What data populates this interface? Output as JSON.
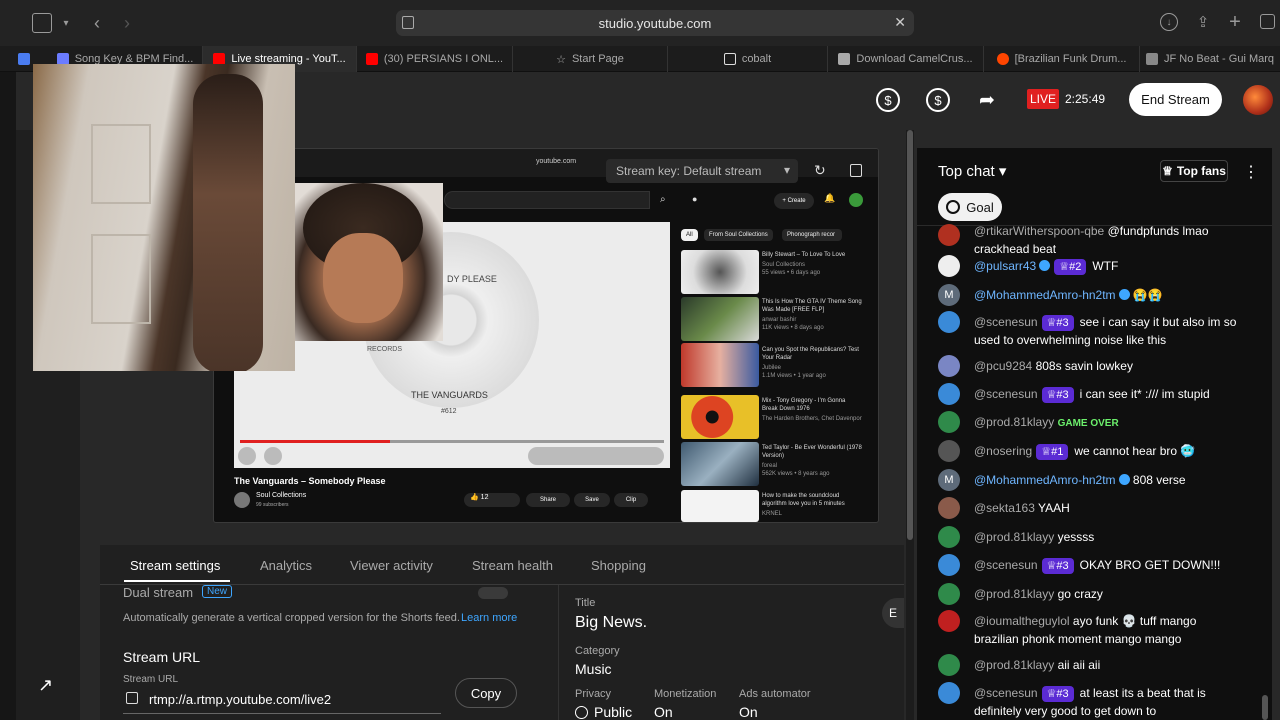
{
  "browser": {
    "url": "studio.youtube.com",
    "tabs": [
      {
        "label": "Song Key & BPM Find...",
        "color": "#6b7cff"
      },
      {
        "label": "Live streaming - YouT...",
        "color": "#ff0000",
        "active": true
      },
      {
        "label": "(30) PERSIANS I ONL...",
        "color": "#ff0000"
      },
      {
        "label": "Start Page",
        "color": "#999999"
      },
      {
        "label": "cobalt",
        "color": "#dddddd"
      },
      {
        "label": "Download CamelCrus...",
        "color": "#aaaaaa"
      },
      {
        "label": "[Brazilian Funk Drum...",
        "color": "#ff4500"
      },
      {
        "label": "JF No Beat - Gui Marq",
        "color": "#888888"
      }
    ]
  },
  "header": {
    "live_label": "LIVE",
    "timer": "2:25:49",
    "end_stream": "End Stream"
  },
  "preview": {
    "stream_key": "Stream key: Default stream",
    "inner_url": "youtube.com",
    "create": "Create",
    "chips": [
      "All",
      "From Soul Collections",
      "Phonograph recor"
    ],
    "video_title": "The Vanguards – Somebody Please",
    "channel": "Soul Collections",
    "subscribers": "99 subscribers",
    "likes": "12",
    "actions": [
      "Share",
      "Save",
      "Clip"
    ],
    "record_title": "THE VANGUARDS",
    "record_label": "RECORDS",
    "record_song": "DY PLEASE",
    "record_number": "#612",
    "suggestions": [
      {
        "title": "Billy Stewart – To Love To Love",
        "meta": "Soul Collections",
        "stats": "55 views • 6 days ago",
        "duration": "2:46"
      },
      {
        "title": "This Is How The GTA IV Theme Song Was Made [FREE FLP]",
        "meta": "anwar bashir",
        "stats": "11K views • 8 days ago",
        "duration": "4:20"
      },
      {
        "title": "Can you Spot the Republicans? Test Your Radar",
        "meta": "Jubilee",
        "stats": "1.1M views • 1 year ago",
        "duration": "16:31"
      },
      {
        "title": "Mix - Tony Gregory - I'm Gonna Break Down 1976",
        "meta": "The Harden Brothers, Chet Davenport, Th...",
        "stats": "",
        "duration": "Mix"
      },
      {
        "title": "Ted Taylor - Be Ever Wonderful (1978 Version)",
        "meta": "foreal",
        "stats": "562K views • 8 years ago",
        "duration": "4:15"
      },
      {
        "title": "How to make the soundcloud algorithm love you in 5 minutes",
        "meta": "KRNEL",
        "stats": "",
        "duration": ""
      }
    ]
  },
  "stream_panel": {
    "tabs": [
      "Stream settings",
      "Analytics",
      "Viewer activity",
      "Stream health",
      "Shopping"
    ],
    "dual_stream": "Dual stream",
    "new_badge": "New",
    "dual_desc": "Automatically generate a vertical cropped version for the Shorts feed.",
    "learn_more": "Learn more",
    "stream_url_heading": "Stream URL",
    "stream_url_label": "Stream URL",
    "stream_url_value": "rtmp://a.rtmp.youtube.com/live2",
    "copy": "Copy",
    "title_label": "Title",
    "title_value": "Big News.",
    "category_label": "Category",
    "category_value": "Music",
    "privacy_label": "Privacy",
    "privacy_value": "Public",
    "monetization_label": "Monetization",
    "monetization_value": "On",
    "ads_label": "Ads automator",
    "ads_value": "On",
    "edit_partial": "E"
  },
  "chat": {
    "mode": "Top chat",
    "top_fans": "Top fans",
    "goal": "Goal",
    "messages": [
      {
        "author": "@rtikarWitherspoon-qbe",
        "badge": "",
        "text": "@fundpfunds lmao crackhead beat",
        "avatar_color": "#b03020"
      },
      {
        "author": "@pulsarr43",
        "badge": "#2",
        "verified": true,
        "text": "WTF",
        "avatar_color": "#eeeeee"
      },
      {
        "author": "@MohammedAmro-hn2tm",
        "badge": "",
        "verified": true,
        "text": "😭😭",
        "avatar_color": "#5e6b7a"
      },
      {
        "author": "@scenesun",
        "badge": "#3",
        "text": "see i can say it but also im so used to overwhelming noise like this",
        "avatar_color": "#3a8ad8"
      },
      {
        "author": "@pcu9284",
        "badge": "",
        "text": "808s savin lowkey",
        "avatar_color": "#7a86c4"
      },
      {
        "author": "@scenesun",
        "badge": "#3",
        "text": "i can see it* :/// im stupid",
        "avatar_color": "#3a8ad8"
      },
      {
        "author": "@prod.81klayy",
        "badge": "",
        "text": "GAME OVER",
        "avatar_color": "#2f8a4a"
      },
      {
        "author": "@nosering",
        "badge": "#1",
        "text": "we cannot hear bro 🥶",
        "avatar_color": "#555555"
      },
      {
        "author": "@MohammedAmro-hn2tm",
        "badge": "",
        "verified": true,
        "text": "808 verse",
        "avatar_color": "#5e6b7a"
      },
      {
        "author": "@sekta163",
        "badge": "",
        "text": "YAAH",
        "avatar_color": "#8a5a4a"
      },
      {
        "author": "@prod.81klayy",
        "badge": "",
        "text": "yessss",
        "avatar_color": "#2f8a4a"
      },
      {
        "author": "@scenesun",
        "badge": "#3",
        "text": "OKAY BRO GET DOWN!!!",
        "avatar_color": "#3a8ad8"
      },
      {
        "author": "@prod.81klayy",
        "badge": "",
        "text": "go crazy",
        "avatar_color": "#2f8a4a"
      },
      {
        "author": "@ioumaltheguylol",
        "badge": "",
        "text": "ayo funk 💀 tuff mango brazilian phonk moment mango mango",
        "avatar_color": "#c02020"
      },
      {
        "author": "@prod.81klayy",
        "badge": "",
        "text": "aii aii aii",
        "avatar_color": "#2f8a4a"
      },
      {
        "author": "@scenesun",
        "badge": "#3",
        "text": "at least its a beat that is definitely very good to get down to",
        "avatar_color": "#3a8ad8"
      }
    ]
  }
}
